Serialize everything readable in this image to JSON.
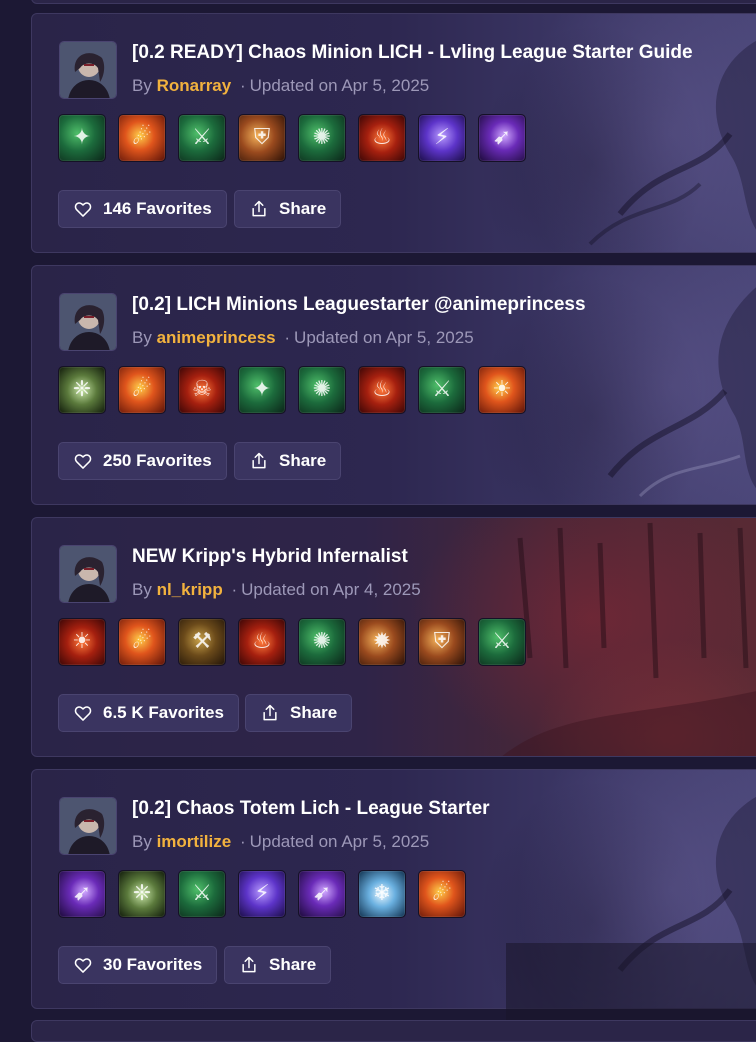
{
  "common": {
    "by_label": "By",
    "updated_label": "Updated on",
    "separator": "·",
    "share_label": "Share"
  },
  "builds": [
    {
      "title": "[0.2 READY] Chaos Minion LICH - Lvling League Starter Guide",
      "author": "Ronarray",
      "updated": "Apr 5, 2025",
      "favorites": "146 Favorites",
      "skills": [
        "s-green",
        "s-fire",
        "s-green",
        "s-orange",
        "s-green",
        "s-red",
        "s-purple",
        "s-violet"
      ],
      "skill_glyphs": [
        "✦",
        "☄",
        "⚔",
        "⛨",
        "✺",
        "♨",
        "⚡",
        "➹"
      ]
    },
    {
      "title": "[0.2] LICH Minions Leaguestarter @animeprincess",
      "author": "animeprincess",
      "updated": "Apr 5, 2025",
      "favorites": "250 Favorites",
      "skills": [
        "s-bone",
        "s-fire",
        "s-red",
        "s-green",
        "s-green",
        "s-red",
        "s-green",
        "s-fire"
      ],
      "skill_glyphs": [
        "❈",
        "☄",
        "☠",
        "✦",
        "✺",
        "♨",
        "⚔",
        "☀"
      ]
    },
    {
      "title": "NEW Kripp's Hybrid Infernalist",
      "author": "nl_kripp",
      "updated": "Apr 4, 2025",
      "favorites": "6.5 K Favorites",
      "skills": [
        "s-red",
        "s-fire",
        "s-earth",
        "s-red",
        "s-green",
        "s-orange",
        "s-orange",
        "s-green"
      ],
      "skill_glyphs": [
        "☀",
        "☄",
        "⚒",
        "♨",
        "✺",
        "✹",
        "⛨",
        "⚔"
      ]
    },
    {
      "title": "[0.2] Chaos Totem Lich - League Starter",
      "author": "imortilize",
      "updated": "Apr 5, 2025",
      "favorites": "30 Favorites",
      "skills": [
        "s-violet",
        "s-bone",
        "s-green",
        "s-purple",
        "s-violet",
        "s-ice",
        "s-fire"
      ],
      "skill_glyphs": [
        "➹",
        "❈",
        "⚔",
        "⚡",
        "➹",
        "❄",
        "☄"
      ]
    }
  ],
  "colors": {
    "author": "#f2b23e",
    "card_border": "#3e3860",
    "button_bg": "#3a3460",
    "page_bg": "#1c1834"
  }
}
